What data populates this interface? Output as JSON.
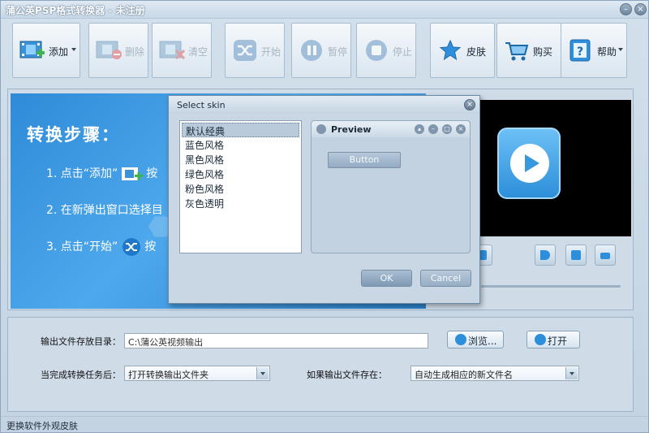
{
  "window": {
    "title": "蒲公英PSP格式转换器 - 未注册"
  },
  "toolbar": {
    "add_label": "添加",
    "delete_label": "删除",
    "clear_label": "清空",
    "start_label": "开始",
    "pause_label": "暂停",
    "stop_label": "停止",
    "skin_label": "皮肤",
    "buy_label": "购买",
    "help_label": "帮助"
  },
  "banner": {
    "title": "转换步骤：",
    "step1": "1. 点击“添加”",
    "step1_tail": "按",
    "step2": "2. 在新弹出窗口选择目",
    "step3": "3. 点击“开始”",
    "step3_tail": "按"
  },
  "settings": {
    "output_dir_label": "输出文件存放目录：",
    "output_dir_value": "C:\\蒲公英视频输出",
    "browse_label": "浏览...",
    "open_label": "打开",
    "after_task_label": "当完成转换任务后：",
    "after_task_value": "打开转换输出文件夹",
    "if_exists_label": "如果输出文件存在：",
    "if_exists_value": "自动生成相应的新文件名"
  },
  "status": {
    "text": "更换软件外观皮肤"
  },
  "dialog": {
    "title": "Select skin",
    "skins": [
      "默认经典",
      "蓝色风格",
      "黑色风格",
      "绿色风格",
      "粉色风格",
      "灰色透明"
    ],
    "selected_skin": "默认经典",
    "preview_title": "Preview",
    "preview_button": "Button",
    "ok_label": "OK",
    "cancel_label": "Cancel"
  }
}
